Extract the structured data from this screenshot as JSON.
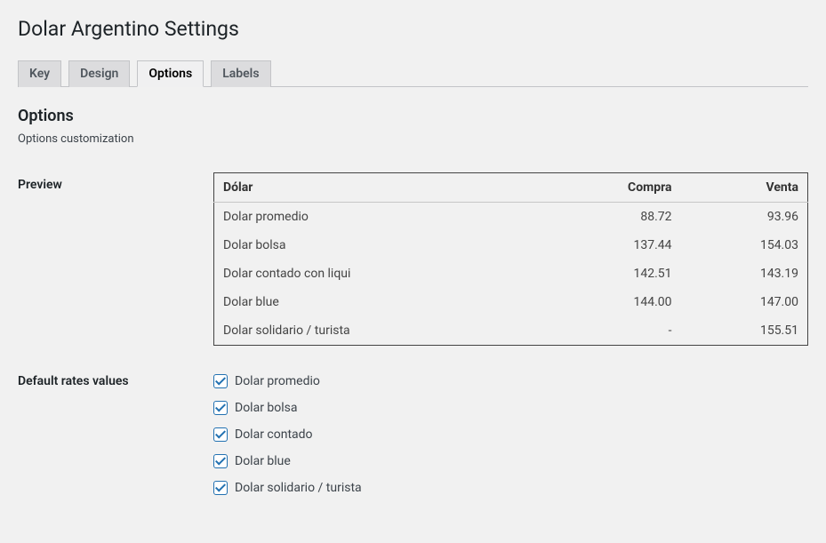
{
  "page_title": "Dolar Argentino Settings",
  "tabs": {
    "key": "Key",
    "design": "Design",
    "options": "Options",
    "labels": "Labels"
  },
  "section": {
    "title": "Options",
    "description": "Options customization"
  },
  "fields": {
    "preview_label": "Preview",
    "default_rates_label": "Default rates values"
  },
  "preview_table": {
    "headers": {
      "name": "Dólar",
      "compra": "Compra",
      "venta": "Venta"
    },
    "rows": [
      {
        "name": "Dolar promedio",
        "compra": "88.72",
        "venta": "93.96"
      },
      {
        "name": "Dolar bolsa",
        "compra": "137.44",
        "venta": "154.03"
      },
      {
        "name": "Dolar contado con liqui",
        "compra": "142.51",
        "venta": "143.19"
      },
      {
        "name": "Dolar blue",
        "compra": "144.00",
        "venta": "147.00"
      },
      {
        "name": "Dolar solidario / turista",
        "compra": "-",
        "venta": "155.51"
      }
    ]
  },
  "default_rates": [
    {
      "label": "Dolar promedio",
      "checked": true
    },
    {
      "label": "Dolar bolsa",
      "checked": true
    },
    {
      "label": "Dolar contado",
      "checked": true
    },
    {
      "label": "Dolar blue",
      "checked": true
    },
    {
      "label": "Dolar solidario / turista",
      "checked": true
    }
  ]
}
